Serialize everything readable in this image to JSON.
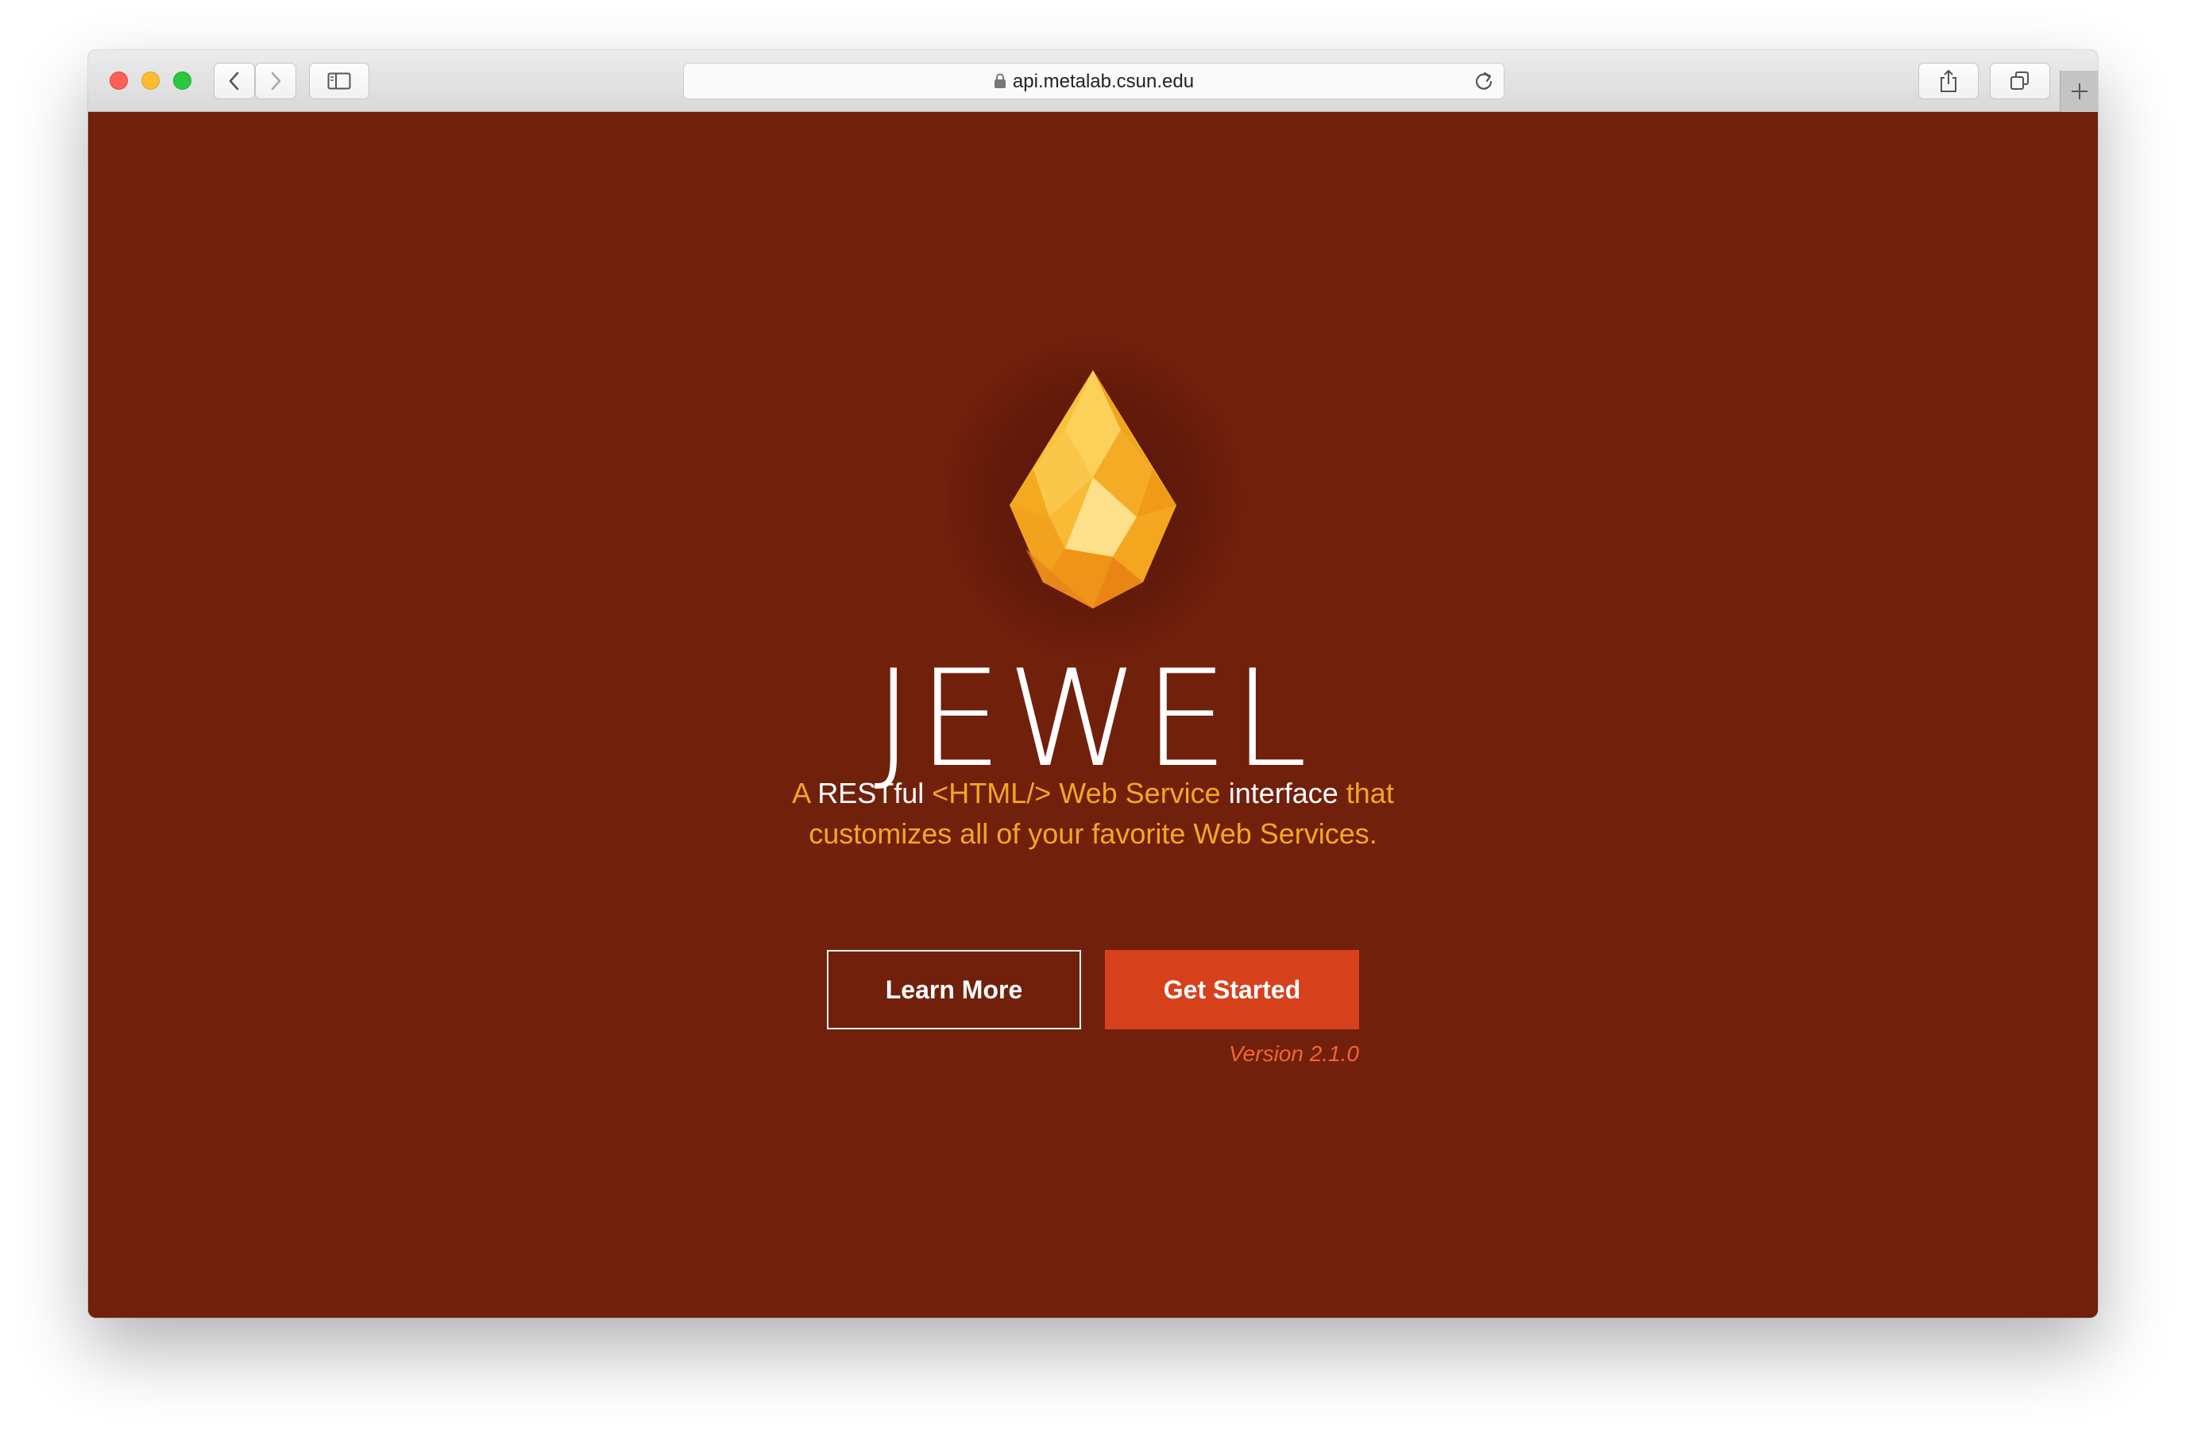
{
  "browser": {
    "url": "api.metalab.csun.edu",
    "icons": {
      "back": "chevron-left-icon",
      "forward": "chevron-right-icon",
      "sidebar": "sidebar-icon",
      "lock": "lock-icon",
      "reload": "reload-icon",
      "share": "share-icon",
      "tabs": "tabs-overview-icon",
      "new_tab": "plus-icon"
    }
  },
  "page": {
    "title": "JEWEL",
    "tagline": {
      "p1": "A ",
      "p2": "RESTful",
      "p3": " <HTML/> Web Service ",
      "p4": "interface",
      "p5": " that",
      "line2": "customizes all of your favorite Web Services."
    },
    "learn_more": "Learn More",
    "get_started": "Get Started",
    "version": "Version 2.1.0"
  },
  "colors": {
    "background": "#71200c",
    "accent_yellow": "#f4a623",
    "primary_button": "#d6401b",
    "version_text": "#f2662e"
  }
}
